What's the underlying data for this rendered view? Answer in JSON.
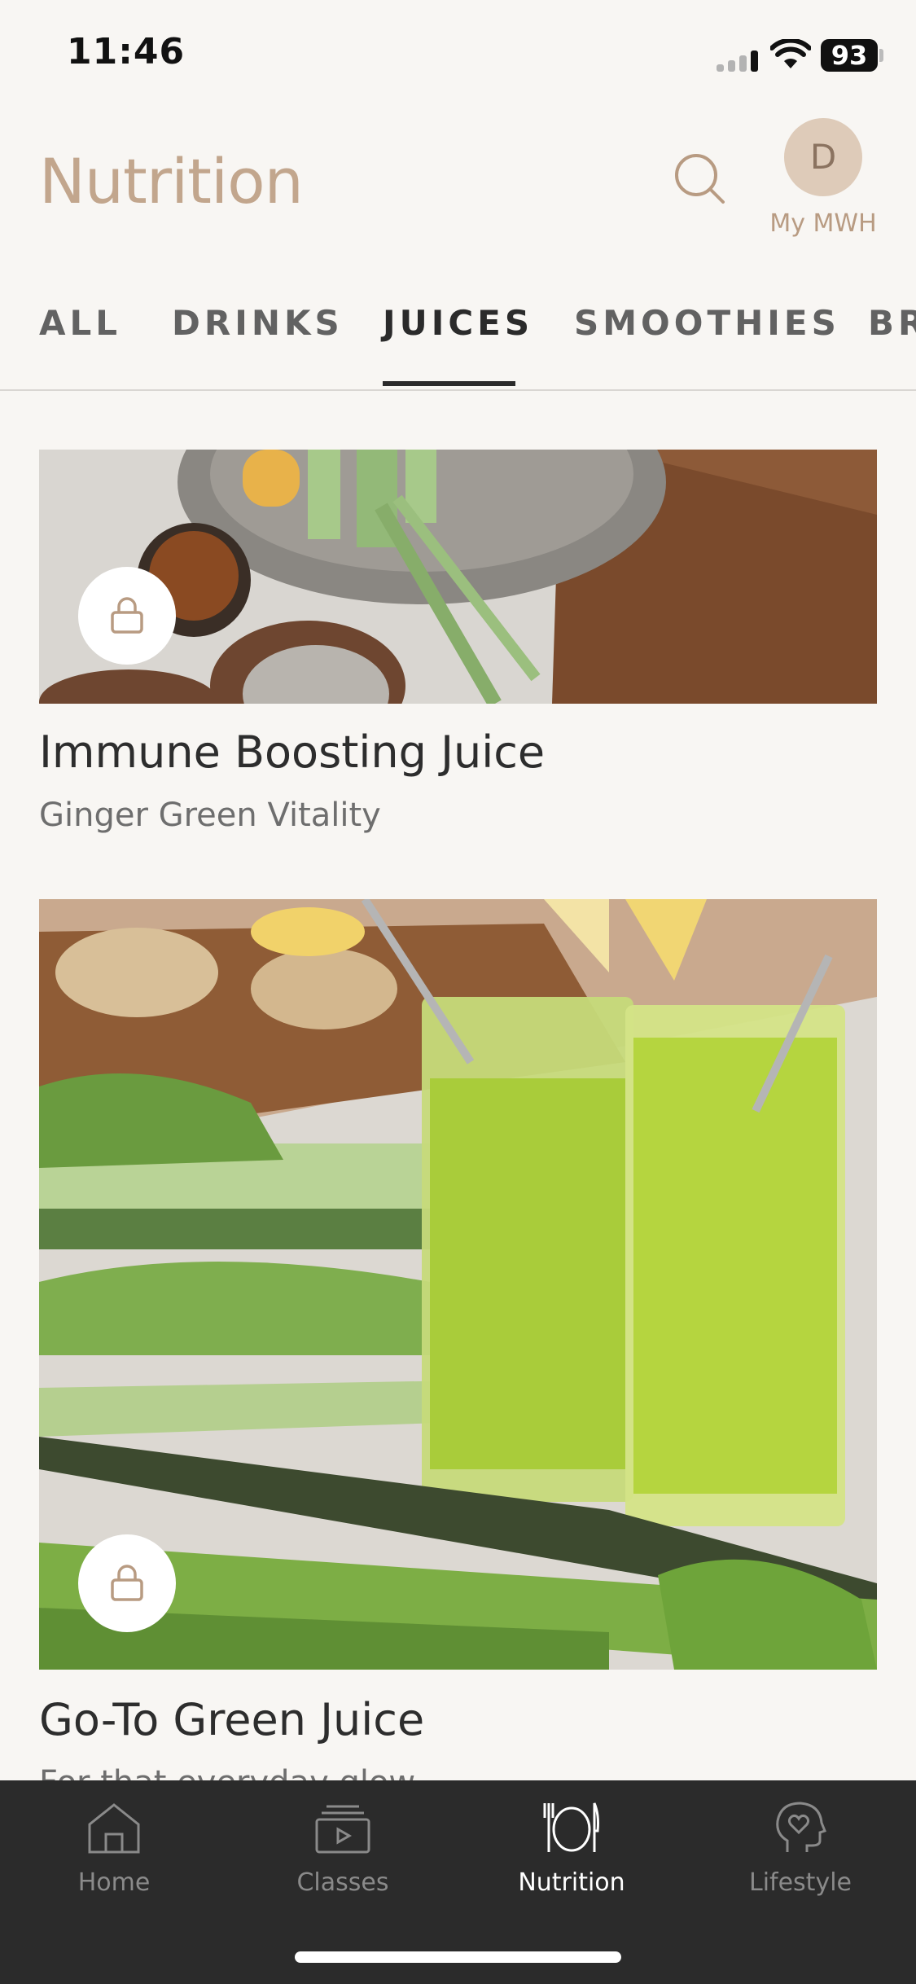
{
  "status_bar": {
    "time": "11:46",
    "battery": "93"
  },
  "header": {
    "title": "Nutrition",
    "avatar_initial": "D",
    "avatar_label": "My MWH"
  },
  "tabs": [
    {
      "label": "ALL"
    },
    {
      "label": "DRINKS"
    },
    {
      "label": "JUICES",
      "active": true
    },
    {
      "label": "SMOOTHIES"
    },
    {
      "label": "BR"
    }
  ],
  "cards": [
    {
      "title": "Immune Boosting Juice",
      "subtitle": "Ginger Green Vitality",
      "locked": true
    },
    {
      "title": "Go-To Green Juice",
      "subtitle": "For that everyday glow",
      "locked": true
    }
  ],
  "tab_bar": {
    "items": [
      {
        "label": "Home",
        "icon": "home-icon"
      },
      {
        "label": "Classes",
        "icon": "classes-icon"
      },
      {
        "label": "Nutrition",
        "icon": "nutrition-icon",
        "active": true
      },
      {
        "label": "Lifestyle",
        "icon": "lifestyle-icon"
      }
    ]
  },
  "colors": {
    "background": "#f8f6f3",
    "accent": "#c2a68d",
    "tab_bar": "#2b2b2b"
  }
}
